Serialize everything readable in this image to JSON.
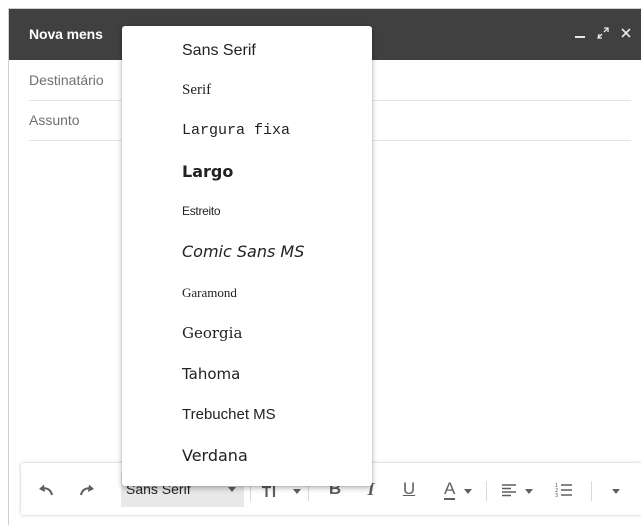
{
  "window": {
    "title": "Nova mens",
    "minimize_icon": "minimize-icon",
    "expand_icon": "expand-icon",
    "close_icon": "close-icon"
  },
  "fields": {
    "to_label": "Destinatário",
    "subject_label": "Assunto"
  },
  "font_menu": {
    "items": [
      "Sans Serif",
      "Serif",
      "Largura fixa",
      "Largo",
      "Estreito",
      "Comic Sans MS",
      "Garamond",
      "Georgia",
      "Tahoma",
      "Trebuchet MS",
      "Verdana"
    ]
  },
  "toolbar": {
    "font_selected": "Sans Serif",
    "bold_label": "B",
    "italic_label": "I",
    "underline_label": "U",
    "text_color_label": "A",
    "icons": [
      "undo-icon",
      "redo-icon",
      "text-size-icon",
      "align-icon",
      "numbered-list-icon",
      "more-formatting-icon"
    ]
  }
}
